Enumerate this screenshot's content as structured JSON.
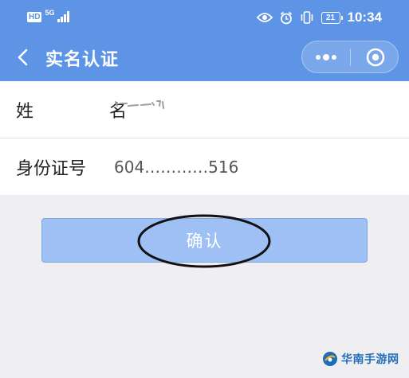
{
  "status_bar": {
    "hd_label": "HD",
    "network_label": "5G",
    "battery_level": "21",
    "time": "10:34"
  },
  "nav": {
    "title": "实名认证"
  },
  "form": {
    "name": {
      "label": "姓 名",
      "value": ""
    },
    "id_number": {
      "label": "身份证号",
      "value": "604…………516"
    }
  },
  "confirm_button": {
    "label": "确认"
  },
  "watermark": {
    "text": "华南手游网"
  },
  "colors": {
    "header_bg": "#5d94e6",
    "button_bg": "#9ec0f4",
    "page_bg": "#eeeef3"
  }
}
